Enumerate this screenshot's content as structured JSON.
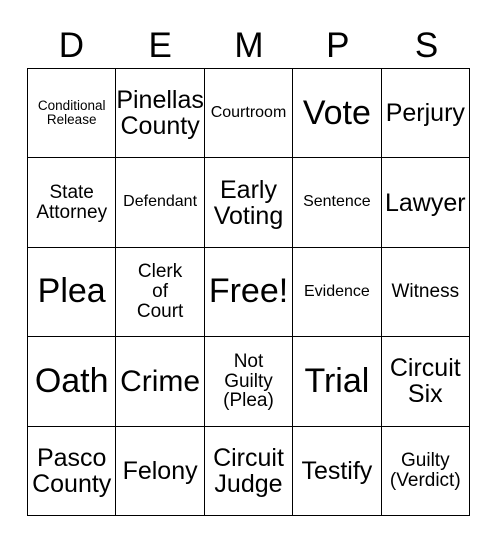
{
  "card": {
    "type": "bingo-card",
    "columns": 5,
    "rows": 5,
    "header_letters": [
      "D",
      "E",
      "M",
      "P",
      "S"
    ],
    "free_space": {
      "row": 3,
      "column": 3,
      "label": "Free!"
    },
    "colors": {
      "background": "#ffffff",
      "border": "#000000",
      "text": "#000000"
    },
    "cells": [
      [
        {
          "text": "Conditional\nRelease",
          "size": "s-xxs"
        },
        {
          "text": "Pinellas\nCounty",
          "size": "s-md"
        },
        {
          "text": "Courtroom",
          "size": "s-xs"
        },
        {
          "text": "Vote",
          "size": "s-xl"
        },
        {
          "text": "Perjury",
          "size": "s-md"
        }
      ],
      [
        {
          "text": "State\nAttorney",
          "size": "s-sm"
        },
        {
          "text": "Defendant",
          "size": "s-xs"
        },
        {
          "text": "Early\nVoting",
          "size": "s-md"
        },
        {
          "text": "Sentence",
          "size": "s-xs"
        },
        {
          "text": "Lawyer",
          "size": "s-md"
        }
      ],
      [
        {
          "text": "Plea",
          "size": "s-xl"
        },
        {
          "text": "Clerk\nof\nCourt",
          "size": "s-sm"
        },
        {
          "text": "Free!",
          "size": "s-xl"
        },
        {
          "text": "Evidence",
          "size": "s-xs"
        },
        {
          "text": "Witness",
          "size": "s-sm"
        }
      ],
      [
        {
          "text": "Oath",
          "size": "s-xl"
        },
        {
          "text": "Crime",
          "size": "s-lg"
        },
        {
          "text": "Not\nGuilty\n(Plea)",
          "size": "s-sm"
        },
        {
          "text": "Trial",
          "size": "s-xl"
        },
        {
          "text": "Circuit\nSix",
          "size": "s-md"
        }
      ],
      [
        {
          "text": "Pasco\nCounty",
          "size": "s-md"
        },
        {
          "text": "Felony",
          "size": "s-md"
        },
        {
          "text": "Circuit\nJudge",
          "size": "s-md"
        },
        {
          "text": "Testify",
          "size": "s-md"
        },
        {
          "text": "Guilty\n(Verdict)",
          "size": "s-sm"
        }
      ]
    ]
  }
}
